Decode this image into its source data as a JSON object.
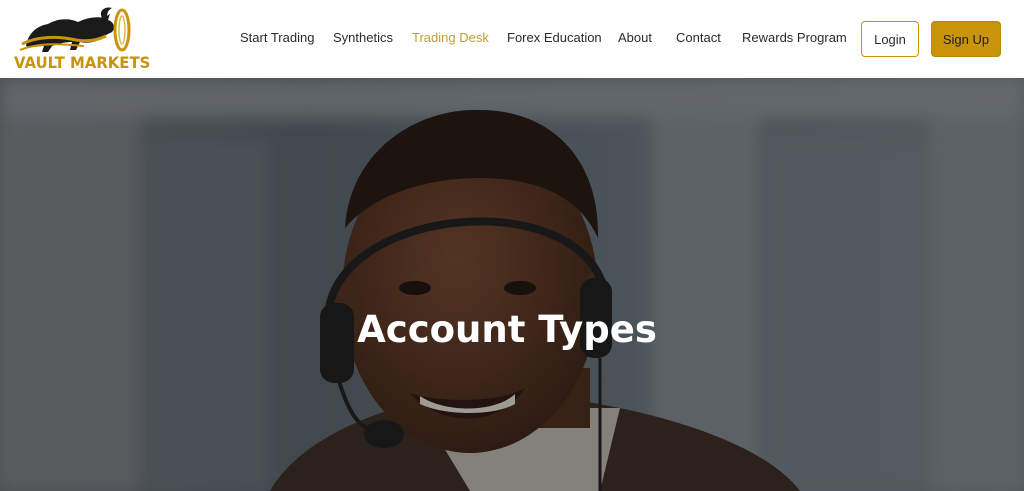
{
  "brand": {
    "logo_text": "VAULT MARKETS",
    "accent_color": "#c8940a"
  },
  "nav": {
    "items": [
      {
        "label": "Start Trading",
        "active": false
      },
      {
        "label": "Synthetics",
        "active": false
      },
      {
        "label": "Trading Desk",
        "active": true
      },
      {
        "label": "Forex Education",
        "active": false
      },
      {
        "label": "About",
        "active": false
      },
      {
        "label": "Contact",
        "active": false
      },
      {
        "label": "Rewards Program",
        "active": false
      }
    ],
    "active_color": "#c29a3a"
  },
  "auth": {
    "login_label": "Login",
    "signup_label": "Sign Up"
  },
  "hero": {
    "title": "Account Types",
    "image": "smiling-man-with-headset-photo"
  }
}
